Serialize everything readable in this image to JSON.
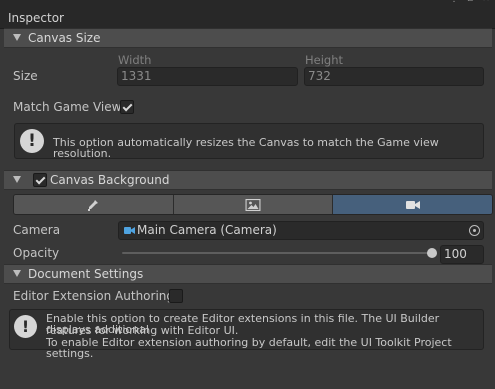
{
  "window": {
    "title": "Inspector"
  },
  "canvas_size": {
    "header": "Canvas Size",
    "size_label": "Size",
    "width_label": "Width",
    "width_value": "1331",
    "height_label": "Height",
    "height_value": "732",
    "match_label": "Match Game View",
    "match_checked": true,
    "help": "This option automatically resizes the Canvas to match the Game view resolution."
  },
  "canvas_background": {
    "header": "Canvas Background",
    "enabled": true,
    "modes": [
      "color-picker-icon",
      "image-icon",
      "camera-icon"
    ],
    "active_mode": 2,
    "camera_label": "Camera",
    "camera_value": "Main Camera (Camera)",
    "opacity_label": "Opacity",
    "opacity_value": "100",
    "opacity_fraction": 1.0
  },
  "document_settings": {
    "header": "Document Settings",
    "editor_ext_label": "Editor Extension Authoring",
    "editor_ext_checked": false,
    "help_line1": "Enable this option to create Editor extensions in this file. The UI Builder displays additional",
    "help_line2": "features for working with Editor UI.",
    "help_line3": "To enable Editor extension authoring by default, edit the UI Toolkit Project settings."
  },
  "colors": {
    "panel_bg": "#383838",
    "header_bg": "#4d4d4d",
    "field_bg": "#2a2a2a",
    "active_tab": "#46607c",
    "camera_icon": "#4fa3e0"
  }
}
